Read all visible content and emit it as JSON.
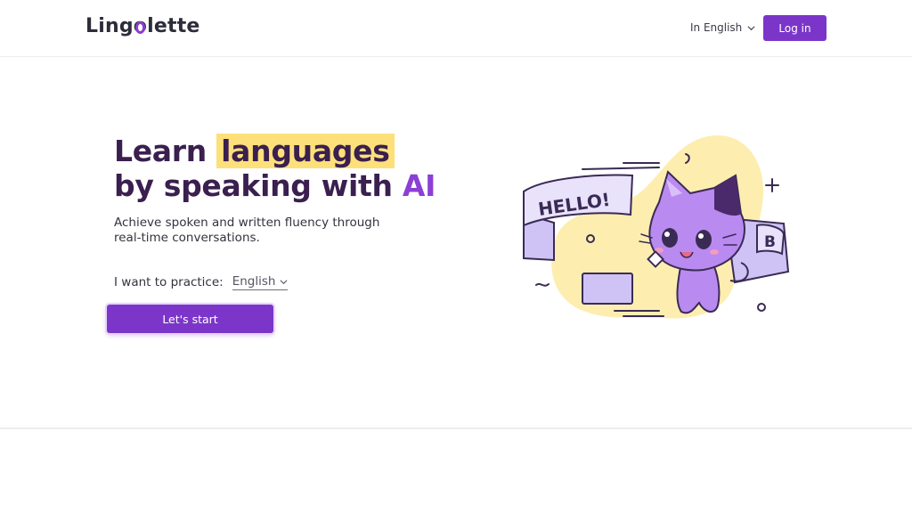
{
  "header": {
    "logo_text_pre": "Ling",
    "logo_text_o": "o",
    "logo_text_post": "lette",
    "interface_language": "In English",
    "login_label": "Log in"
  },
  "hero": {
    "title_line1_a": "Learn ",
    "title_line1_highlight": "languages",
    "title_line2_a": "by speaking with ",
    "title_line2_ai": "AI",
    "subtitle": "Achieve spoken and written fluency through real-time conversations.",
    "practice_label": "I want to practice:",
    "practice_language": "English",
    "start_label": "Let's start"
  },
  "illustration": {
    "bubble_text": "HELLO!",
    "letter_badge": "B",
    "colors": {
      "blob": "#fdeeb0",
      "cat": "#b98af0",
      "cat_dark": "#4a2a6a",
      "ribbon": "#cfc3f5",
      "stroke": "#3a2b55"
    }
  },
  "colors": {
    "accent": "#7b36c9",
    "highlight": "#fde07a",
    "title": "#3a1f4f"
  }
}
